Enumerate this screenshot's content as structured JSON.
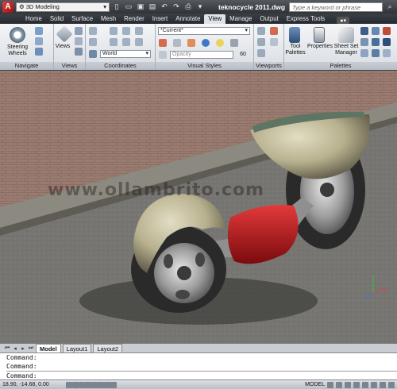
{
  "titlebar": {
    "logo": "A",
    "workspace": "3D Modeling",
    "document_title": "teknocycle 2011.dwg",
    "search_placeholder": "Type a keyword or phrase"
  },
  "tabs": [
    "Home",
    "Solid",
    "Surface",
    "Mesh",
    "Render",
    "Insert",
    "Annotate",
    "View",
    "Manage",
    "Output",
    "Express Tools"
  ],
  "active_tab": "View",
  "ribbon": {
    "navigate": {
      "label": "Navigate",
      "steering_wheels": "Steering Wheels"
    },
    "views": {
      "label": "Views",
      "views_button": "Views"
    },
    "coordinates": {
      "label": "Coordinates",
      "ucs_world": "World"
    },
    "visual_styles": {
      "label": "Visual Styles",
      "current_style": "*Current*",
      "opacity_label": "Opacity",
      "opacity_value": "60"
    },
    "viewports": {
      "label": "Viewports"
    },
    "palettes": {
      "label": "Palettes",
      "tool_palettes": "Tool Palettes",
      "properties": "Properties",
      "sheet_set_manager": "Sheet Set Manager"
    }
  },
  "viewport": {
    "watermark": "www.ollambrito.com"
  },
  "layout_tabs": [
    "Model",
    "Layout1",
    "Layout2"
  ],
  "active_layout": "Model",
  "command_line": {
    "history": [
      "Command:",
      "Command:"
    ],
    "prompt": "Command:"
  },
  "statusbar": {
    "coordinates": "18.90, -14.68, 0.00",
    "mode": "MODEL"
  },
  "colors": {
    "ribbon_bg": "#e4e7eb",
    "titlebar": "#3b4047",
    "vehicle_body": "#b8b18f",
    "vehicle_seat": "#c0141a"
  }
}
